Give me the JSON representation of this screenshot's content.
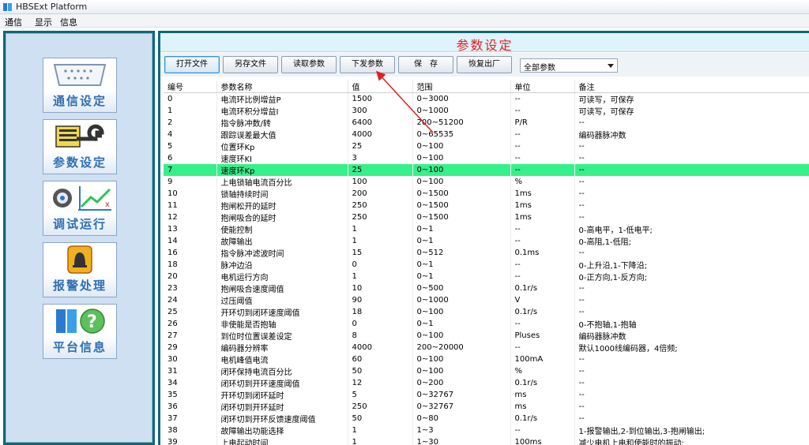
{
  "window": {
    "title": "HBSExt Platform"
  },
  "menu": [
    "通信",
    "显示",
    "信息"
  ],
  "sidebar": {
    "items": [
      {
        "label": "通信设定",
        "icon": "serial-port-icon"
      },
      {
        "label": "参数设定",
        "icon": "parameter-tools-icon"
      },
      {
        "label": "调试运行",
        "icon": "debug-run-icon"
      },
      {
        "label": "报警处理",
        "icon": "alarm-bell-icon"
      },
      {
        "label": "平台信息",
        "icon": "help-info-icon"
      }
    ]
  },
  "main": {
    "title": "参数设定",
    "toolbar": {
      "buttons": [
        "打开文件",
        "另存文件",
        "读取参数",
        "下发参数",
        "保　存",
        "恢复出厂"
      ],
      "filter_value": "全部参数"
    },
    "columns": [
      "编号",
      "参数名称",
      "值",
      "范围",
      "单位",
      "备注"
    ],
    "selected_row": 7,
    "rows": [
      [
        "0",
        "电流环比例增益P",
        "1500",
        "0~3000",
        "--",
        "可读写，可保存"
      ],
      [
        "1",
        "电流环积分增益I",
        "300",
        "0~1000",
        "--",
        "可读写，可保存"
      ],
      [
        "2",
        "指令脉冲数/转",
        "6400",
        "200~51200",
        "P/R",
        "--"
      ],
      [
        "4",
        "跟踪误差最大值",
        "4000",
        "0~65535",
        "--",
        "编码器脉冲数"
      ],
      [
        "5",
        "位置环Kp",
        "25",
        "0~100",
        "--",
        "--"
      ],
      [
        "6",
        "速度环KI",
        "3",
        "0~100",
        "--",
        "--"
      ],
      [
        "7",
        "速度环Kp",
        "25",
        "0~100",
        "--",
        "--"
      ],
      [
        "9",
        "上电锁轴电流百分比",
        "100",
        "0~100",
        "%",
        "--"
      ],
      [
        "10",
        "锁轴持续时间",
        "200",
        "0~1500",
        "1ms",
        "--"
      ],
      [
        "11",
        "抱闸松开的延时",
        "250",
        "0~1500",
        "1ms",
        "--"
      ],
      [
        "12",
        "抱闸吸合的延时",
        "250",
        "0~1500",
        "1ms",
        "--"
      ],
      [
        "13",
        "使能控制",
        "1",
        "0~1",
        "--",
        "0-高电平，1-低电平;"
      ],
      [
        "14",
        "故障输出",
        "1",
        "0~1",
        "--",
        "0-高阻,1-低阻;"
      ],
      [
        "16",
        "指令脉冲滤波时间",
        "15",
        "0~512",
        "0.1ms",
        "--"
      ],
      [
        "18",
        "脉冲边沿",
        "0",
        "0~1",
        "--",
        "0-上升沿,1-下降沿;"
      ],
      [
        "20",
        "电机运行方向",
        "1",
        "0~1",
        "--",
        "0-正方向,1-反方向;"
      ],
      [
        "23",
        "抱闸吸合速度阈值",
        "10",
        "0~500",
        "0.1r/s",
        "--"
      ],
      [
        "24",
        "过压阈值",
        "90",
        "0~1000",
        "V",
        "--"
      ],
      [
        "25",
        "开环切到闭环速度阈值",
        "18",
        "0~100",
        "0.1r/s",
        "--"
      ],
      [
        "26",
        "非使能是否抱轴",
        "0",
        "0~1",
        "--",
        "0-不抱轴,1-抱轴"
      ],
      [
        "27",
        "到位时位置误差设定",
        "8",
        "0~100",
        "Pluses",
        "编码器脉冲数"
      ],
      [
        "29",
        "编码器分辨率",
        "4000",
        "200~20000",
        "--",
        "默认1000线编码器，4倍频;"
      ],
      [
        "30",
        "电机峰值电流",
        "60",
        "0~100",
        "100mA",
        "--"
      ],
      [
        "31",
        "闭环保持电流百分比",
        "50",
        "0~100",
        "%",
        "--"
      ],
      [
        "34",
        "闭环切到开环速度阈值",
        "12",
        "0~200",
        "0.1r/s",
        "--"
      ],
      [
        "35",
        "开环切到闭环延时",
        "5",
        "0~32767",
        "ms",
        "--"
      ],
      [
        "36",
        "闭环切到开环延时",
        "250",
        "0~32767",
        "ms",
        "--"
      ],
      [
        "37",
        "闭环切到开环反馈速度阈值",
        "50",
        "0~80",
        "0.1r/s",
        "--"
      ],
      [
        "38",
        "故障输出功能选择",
        "1",
        "1~3",
        "--",
        "1-报警输出,2-到位输出,3-抱闸输出;"
      ],
      [
        "39",
        "上电起动时间",
        "1",
        "1~30",
        "100ms",
        "减少电机上电和使能时的振动;"
      ]
    ]
  },
  "colors": {
    "frame": "#0b6a74",
    "selected_row": "#36f08a",
    "title_red": "#e02020",
    "nav_text": "#2f6fb2"
  }
}
